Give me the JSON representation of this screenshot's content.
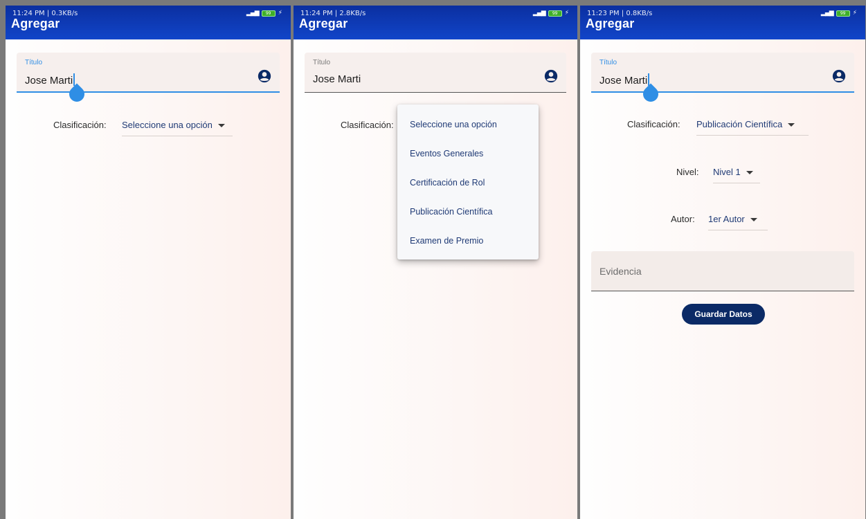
{
  "screens": [
    {
      "status_time": "11:24 PM | 0.3KB/s",
      "app_title": "Agregar",
      "title_field": {
        "label": "Título",
        "value": "Jose Marti"
      },
      "classification": {
        "label": "Clasificación:",
        "selected": "Seleccione una opción"
      }
    },
    {
      "status_time": "11:24 PM | 2.8KB/s",
      "app_title": "Agregar",
      "title_field": {
        "label": "Título",
        "value": "Jose Marti"
      },
      "classification": {
        "label": "Clasificación:",
        "options": [
          "Seleccione una opción",
          "Eventos Generales",
          "Certificación de Rol",
          "Publicación Científica",
          "Examen de Premio"
        ]
      }
    },
    {
      "status_time": "11:23 PM | 0.8KB/s",
      "app_title": "Agregar",
      "title_field": {
        "label": "Título",
        "value": "Jose Marti"
      },
      "classification": {
        "label": "Clasificación:",
        "selected": "Publicación Científica"
      },
      "nivel": {
        "label": "Nivel:",
        "selected": "Nivel 1"
      },
      "autor": {
        "label": "Autor:",
        "selected": "1er Autor"
      },
      "evidence": {
        "label": "Evidencia"
      },
      "save_button": "Guardar Datos"
    }
  ],
  "status_battery": "99",
  "colors": {
    "appbar": "#1145c9",
    "accent": "#2f8ee5",
    "button": "#0b2a66",
    "dropdown_text": "#1f3a75"
  },
  "icons": [
    "account-circle-icon",
    "dropdown-arrow-icon",
    "signal-icon",
    "battery-icon",
    "charging-icon"
  ]
}
